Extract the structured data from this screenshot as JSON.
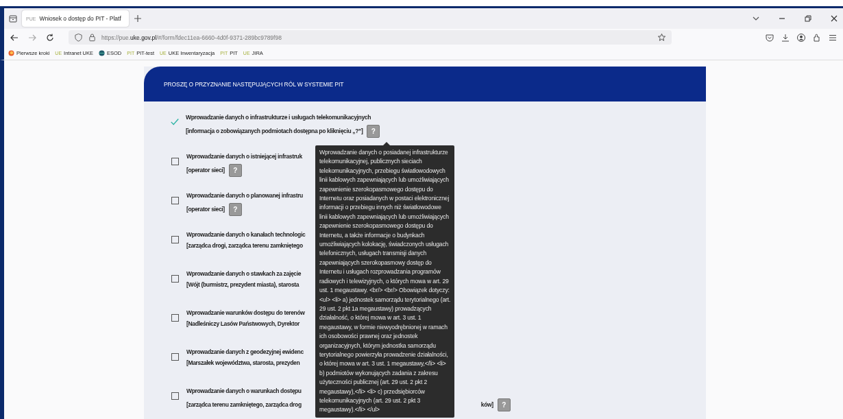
{
  "browser": {
    "tab_title": "Wniosek o dostęp do PIT - Platf",
    "tab_favicon": "PUE",
    "address": {
      "prefix": "https://pue.",
      "domain": "uke.gov.pl",
      "rest": "/#/form/fdec11ea-6660-4d0f-9371-289bc9789f98"
    },
    "bookmarks": [
      {
        "label": "Pierwsze kroki",
        "kind": "firefox"
      },
      {
        "badge": "UE",
        "label": "Intranet UKE",
        "kind": "text"
      },
      {
        "label": "ESOD",
        "kind": "globe"
      },
      {
        "badge": "PIT",
        "label": "PIT-test",
        "kind": "text"
      },
      {
        "badge": "UE",
        "label": "UKE Inwentaryzacja",
        "kind": "text"
      },
      {
        "badge": "PIT",
        "label": "PIT",
        "kind": "text"
      },
      {
        "badge": "UE",
        "label": "JIRA",
        "kind": "text"
      }
    ]
  },
  "section": {
    "title": "PROSZĘ O PRZYZNANIE NASTĘPUJĄCYCH RÓL W SYSTEMIE PIT"
  },
  "roles": [
    {
      "checked": true,
      "title": "Wprowadzanie danych o infrastrukturze i usługach telekomunikacyjnych",
      "subtitle": "[informacja o zobowiązanych podmiotach dostępna po kliknięciu „?”]",
      "help": "?"
    },
    {
      "checked": false,
      "title": "Wprowadzanie danych o istniejącej infrastruk",
      "subtitle": "[operator sieci]",
      "help": "?"
    },
    {
      "checked": false,
      "title": "Wprowadzanie danych o planowanej infrastru",
      "subtitle": "[operator sieci]",
      "help": "?"
    },
    {
      "checked": false,
      "title": "Wprowadzanie danych o kanałach technologic",
      "subtitle": "[zarządca drogi, zarządca terenu zamkniętego"
    },
    {
      "checked": false,
      "title": "Wprowadzanie danych o stawkach za zajęcie",
      "subtitle": "[Wójt (burmistrz, prezydent miasta), starosta"
    },
    {
      "checked": false,
      "title": "Wprowadzanie warunków dostępu do terenów",
      "subtitle": "[Nadleśniczy Lasów Państwowych, Dyrektor"
    },
    {
      "checked": false,
      "title": "Wprowadzanie danych z geodezyjnej ewidenc",
      "subtitle": "[Marszałek województwa, starosta, prezyden"
    },
    {
      "checked": false,
      "title": "Wprowadzanie danych o warunkach dostępu",
      "subtitle": "[zarządca terenu zamkniętego, zarządca drog",
      "subtitle_end": "ków]",
      "help": "?"
    }
  ],
  "tooltip": {
    "lines": [
      "Wprowadzanie danych o posiadanej infrastrukturze",
      "telekomunikacyjnej, publicznych sieciach",
      "telekomunikacyjnych, przebiegu światłowodowych",
      "linii kablowych zapewniających lub umożliwiających",
      "zapewnienie szerokopasmowego dostępu do",
      "Internetu oraz posiadanych w postaci elektronicznej",
      "informacji o przebiegu innych niż światłowodowe",
      "linii kablowych zapewniających lub umożliwiających",
      "zapewnienie szerokopasmowego dostępu do",
      "Internetu, a także informacje o budynkach",
      "umożliwiających kolokację, świadczonych usługach",
      "telefonicznych, usługach transmisji danych",
      "zapewniających szerokopasmowy dostęp do",
      "Internetu i usługach rozprowadzania programów",
      "radiowych i telewizyjnych, o których mowa w art. 29",
      "ust. 1 megaustawy. <br/> <br/> Obowiązek dotyczy:",
      "<ul> <li> a) jednostek samorządu terytorialnego (art.",
      "29 ust. 2 pkt 1a megaustawy) prowadzących",
      "działalność, o której mowa w art. 3 ust. 1",
      "megaustawy, w formie niewyodrębnionej w ramach",
      "ich osobowości prawnej oraz jednostek",
      "organizacyjnych, którym jednostka samorządu",
      "terytorialnego powierzyła prowadzenie działalności,",
      "o której mowa w art. 3 ust. 1 megaustawy,</li> <li>",
      "b) podmiotów wykonujących zadania z zakresu",
      "użyteczności publicznej (art. 29 ust. 2 pkt 2",
      "megaustawy),</li> <li> c) przedsiębiorców",
      "telekomunikacyjnych (art. 29 ust. 2 pkt 3",
      "megaustawy).</li> </ul>"
    ]
  }
}
